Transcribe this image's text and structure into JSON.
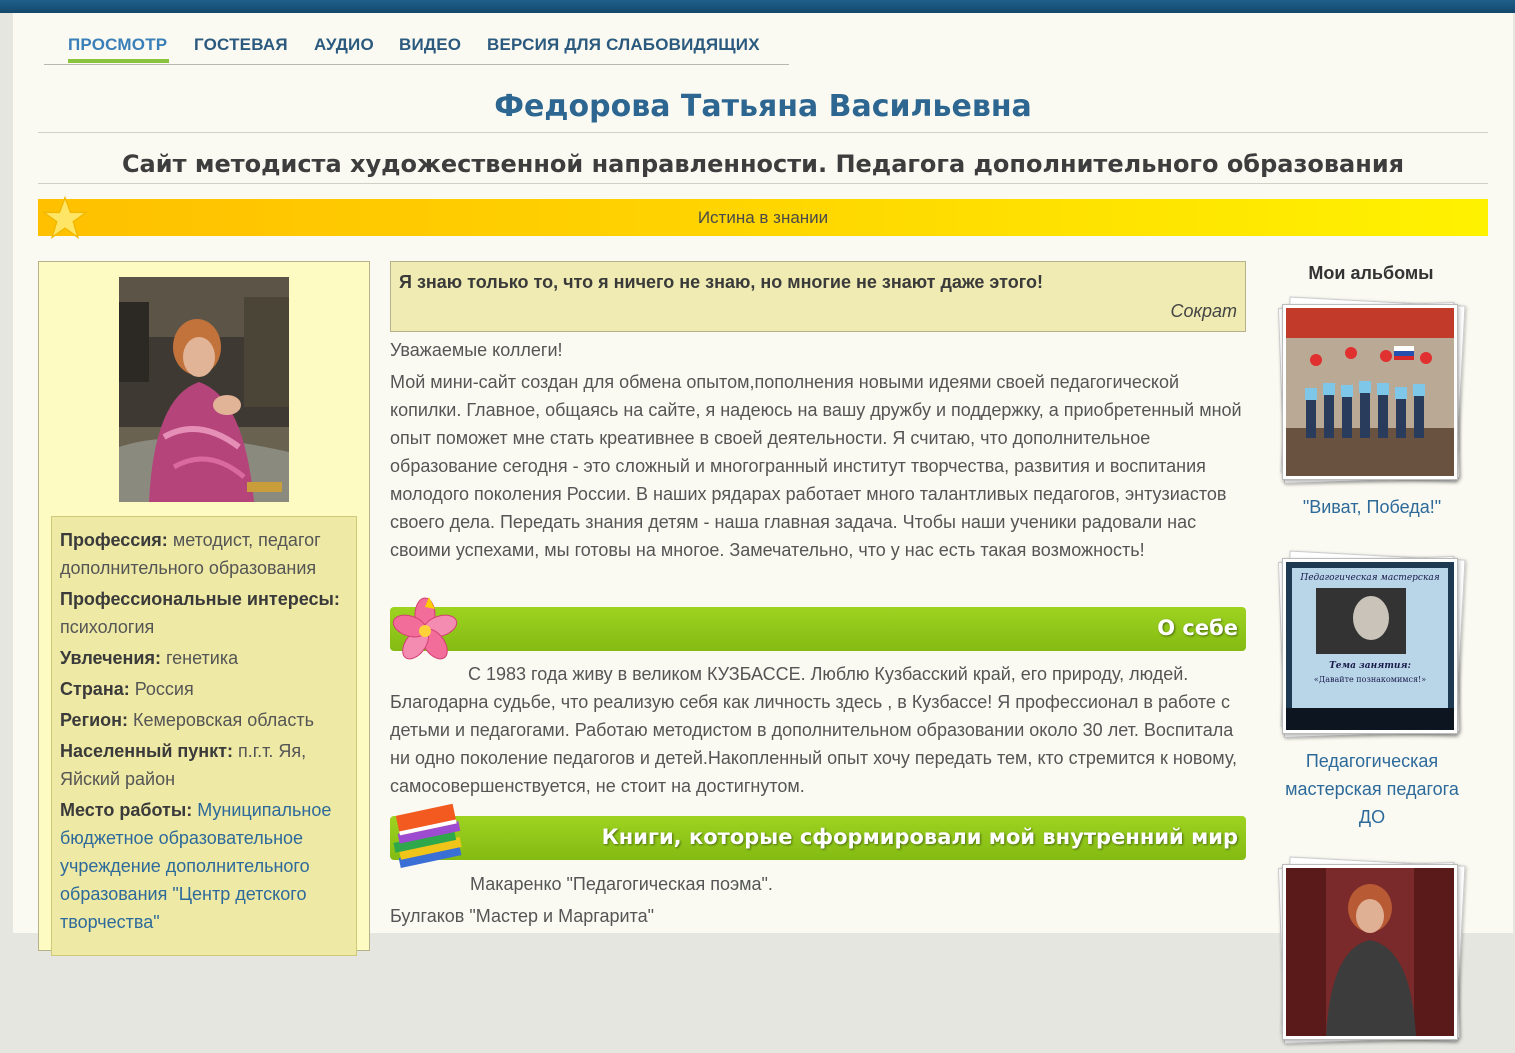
{
  "nav": {
    "items": [
      "ПРОСМОТР",
      "ГОСТЕВАЯ",
      "АУДИО",
      "ВИДЕО",
      "ВЕРСИЯ ДЛЯ СЛАБОВИДЯЩИХ"
    ],
    "active": "ПРОСМОТР"
  },
  "header": {
    "title": "Федорова Татьяна Васильевна",
    "subtitle": "Сайт методиста художественной направленности. Педагога дополнительного образования",
    "motto": "Истина в знании"
  },
  "profile": {
    "profession_label": "Профессия:",
    "profession_value": " методист, педагог дополнительного образования",
    "interests_label": "Профессиональные интересы:",
    "interests_value": " психология",
    "hobbies_label": "Увлечения:",
    "hobbies_value": " генетика",
    "country_label": "Страна:",
    "country_value": " Россия",
    "region_label": "Регион:",
    "region_value": " Кемеровская область",
    "city_label": "Населенный пункт:",
    "city_value": " п.г.т. Яя, Яйский район",
    "work_label": "Место работы:",
    "work_value": " Муниципальное бюджетное образовательное учреждение дополнительного образования \"Центр детского творчества\""
  },
  "quote": {
    "text": "Я знаю только то, что я ничего не знаю, но многие не знают даже этого!",
    "author": "Сократ"
  },
  "main": {
    "greeting": "Уважаемые коллеги!",
    "intro": "Мой мини-сайт создан для обмена опытом,пополнения новыми идеями своей педагогической копилки. Главное, общаясь на сайте, я надеюсь на вашу дружбу и поддержку, а приобретенный мной опыт поможет мне стать креативнее в своей деятельности. Я считаю, что дополнительное образование сегодня - это сложный и многогранный институт творчества, развития и воспитания молодого поколения России. В наших рядарах работает  много талантливых педагогов, энтузиастов своего дела. Передать знания детям - наша главная задача. Чтобы наши ученики радовали нас своими успехами, мы готовы на многое. Замечательно, что у нас есть такая возможность!",
    "about_heading": "О себе",
    "about_text": "С 1983 года живу в великом КУЗБАССЕ. Люблю Кузбасский край, его природу, людей. Благодарна судьбе, что реализую себя как личность здесь , в Кузбассе! Я профессионал в работе с детьми и педагогами. Работаю методистом в дополнительном образовании около 30 лет. Воспитала ни одно поколение педагогов и детей.Накопленный опыт хочу передать тем, кто стремится к новому, самосовершенствуется, не стоит на достигнутом.",
    "books_heading": "Книги, которые сформировали мой внутренний мир",
    "books": [
      "Макаренко \"Педагогическая поэма\".",
      "Булгаков \"Мастер и Маргарита\""
    ]
  },
  "albums": {
    "title": "Мои альбомы",
    "items": [
      {
        "caption": "\"Виват, Победа!\""
      },
      {
        "caption": "Педагогическая мастерская педагога ДО",
        "slide_title": "Педагогическая мастерская",
        "slide_topic": "Тема занятия:",
        "slide_subtitle": "«Давайте познакомимся!»"
      },
      {
        "caption": ""
      }
    ]
  },
  "icons": [
    "star-icon",
    "flower-icon",
    "books-icon"
  ],
  "colors": {
    "nav_text": "#2b5a7e",
    "title": "#2d6690",
    "accent_green": "#8ac43f",
    "motto_yellow": "#ffd300",
    "link": "#2d6a9a"
  }
}
